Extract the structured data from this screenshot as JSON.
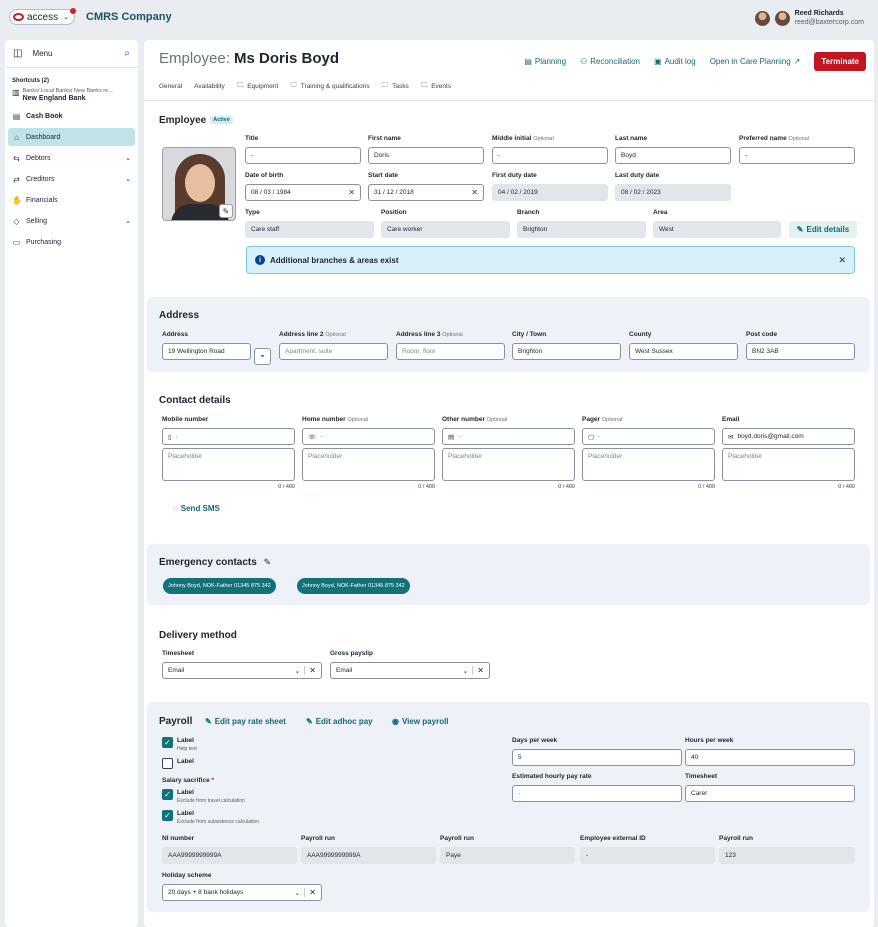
{
  "brand": {
    "logo": "access",
    "company": "CMRS Company"
  },
  "user": {
    "name": "Reed Richards",
    "email": "reed@baxtercorp.com"
  },
  "sidebar": {
    "menu_label": "Menu",
    "shortcuts_label": "Shortcuts (2)",
    "bank_path": "Banks/ Local Banks/ New Banks re...",
    "bank_name": "New England Bank",
    "cash_book": "Cash Book",
    "items": [
      {
        "label": "Dashboard",
        "icon": "home-icon"
      },
      {
        "label": "Debtors",
        "icon": "debtors-icon"
      },
      {
        "label": "Creditors",
        "icon": "creditors-icon"
      },
      {
        "label": "Financials",
        "icon": "financials-icon"
      },
      {
        "label": "Selling",
        "icon": "tag-icon"
      },
      {
        "label": "Purchasing",
        "icon": "purchasing-icon"
      }
    ]
  },
  "header": {
    "prefix": "Employee:",
    "name": "Ms Doris Boyd",
    "planning": "Planning",
    "reconciliation": "Reconciliation",
    "audit": "Audit log",
    "open_planning": "Open in Care Planning",
    "terminate": "Terminate"
  },
  "tabs": [
    "General",
    "Availability",
    "Equipment",
    "Training & qualifications",
    "Tasks",
    "Events"
  ],
  "employee": {
    "title": "Employee",
    "status": "Active",
    "labels": {
      "title": "Title",
      "first": "First name",
      "middle": "Middle initial",
      "optional": "Optional",
      "last": "Last name",
      "preferred": "Preferred name",
      "dob": "Date of birth",
      "start": "Start date",
      "first_duty": "First duty date",
      "last_duty": "Last duty date",
      "type": "Type",
      "position": "Position",
      "branch": "Branch",
      "area": "Area"
    },
    "values": {
      "title": "-",
      "first": "Doris",
      "middle": "-",
      "last": "Boyd",
      "preferred": "-",
      "dob": "08 / 03 / 1984",
      "start": "31 / 12 / 2018",
      "first_duty": "04 / 02 / 2019",
      "last_duty": "08 / 02 / 2023",
      "type": "Care staff",
      "position": "Care worker",
      "branch": "Brighton",
      "area": "West"
    },
    "edit_details": "Edit details",
    "alert": "Additional branches & areas exist"
  },
  "address": {
    "title": "Address",
    "l_addr": "Address",
    "l_addr2": "Address line 2",
    "l_addr3": "Address line 3",
    "optional": "Optional",
    "l_city": "City / Town",
    "l_county": "County",
    "l_post": "Post code",
    "addr": "19 Wellington Road",
    "addr2_ph": "Apartment, suite",
    "addr3_ph": "Room, floor",
    "city": "Brighton",
    "county": "West Sussex",
    "post": "BN2 3AB"
  },
  "contact": {
    "title": "Contact details",
    "l_mobile": "Mobile number",
    "l_home": "Home number",
    "l_other": "Other number",
    "l_pager": "Pager",
    "l_email": "Email",
    "optional": "Optional",
    "mobile": "-",
    "home": "-",
    "other": "-",
    "pager": "-",
    "email": "boyd.doris@gmail.com",
    "placeholder": "Placeholder",
    "count": "0 / 400",
    "send_sms": "Send SMS"
  },
  "emergency": {
    "title": "Emergency contacts",
    "chips": [
      "Johnny Boyd, NOK-Father  01345 875 342",
      "Johnny Boyd, NOK-Father  01345 875 342"
    ]
  },
  "delivery": {
    "title": "Delivery method",
    "l_timesheet": "Timesheet",
    "l_payslip": "Gross payslip",
    "timesheet": "Email",
    "payslip": "Email"
  },
  "payroll": {
    "title": "Payroll",
    "edit_rate": "Edit pay rate sheet",
    "edit_adhoc": "Edit adhoc pay",
    "view": "View payroll",
    "cb1": "Label",
    "cb1_help": "Help text",
    "cb2": "Label",
    "salary": "Salary sacrifice",
    "req": "*",
    "cb3": "Label",
    "cb3_help": "Exclude from travel calculation",
    "cb4": "Label",
    "cb4_help": "Exclude from subsistence calculation",
    "l_days": "Days per week",
    "days": "5",
    "l_hours": "Hours per week",
    "hours": "40",
    "l_rate": "Estimated hourly pay rate",
    "rate": "-",
    "l_timesheet": "Timesheet",
    "timesheet": "Carer",
    "l_ni": "NI number",
    "ni": "AAA9999999999A",
    "l_run1": "Payroll run",
    "run1": "AAA9999999999A",
    "l_run2": "Payroll run",
    "run2": "Paye",
    "l_ext": "Employee external ID",
    "ext": "-",
    "l_run3": "Payroll run",
    "run3": "123",
    "l_holiday": "Holiday scheme",
    "holiday": "20 days + 8 bank holidays"
  }
}
